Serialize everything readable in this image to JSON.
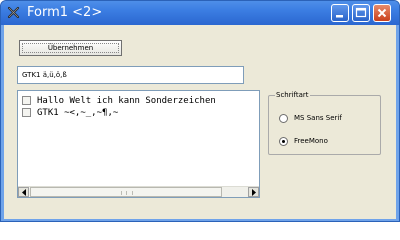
{
  "window": {
    "title": "Form1 <2>",
    "controls": {
      "minimize_icon": "minimize-icon",
      "maximize_icon": "maximize-icon",
      "close_icon": "close-icon"
    }
  },
  "toolbar": {
    "apply_label": "Übernehmen"
  },
  "edit": {
    "value": "GTK1 ä,ü,ö,ß"
  },
  "list": {
    "items": [
      {
        "text": "Hallo Welt ich kann Sonderzeichen",
        "checked": false
      },
      {
        "text": "GTK1 ~<,~_,~¶,~",
        "checked": false
      }
    ]
  },
  "font_group": {
    "legend": "Schriftart",
    "options": [
      {
        "label": "MS Sans Serif",
        "selected": false
      },
      {
        "label": "FreeMono",
        "selected": true
      }
    ]
  },
  "colors": {
    "title_bar": "#3b7de2",
    "client_bg": "#ece9d8",
    "close_button": "#c9401c"
  }
}
